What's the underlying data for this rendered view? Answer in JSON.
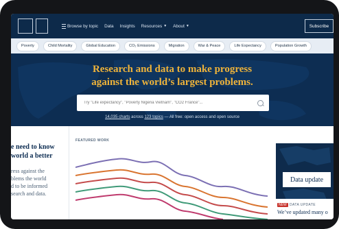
{
  "header": {
    "nav": [
      {
        "label": "Browse by topic",
        "icon": "menu-icon",
        "caret": false
      },
      {
        "label": "Data",
        "caret": false
      },
      {
        "label": "Insights",
        "caret": false
      },
      {
        "label": "Resources",
        "caret": true
      },
      {
        "label": "About",
        "caret": true
      }
    ],
    "subscribe_label": "Subscribe"
  },
  "topics": [
    "Poverty",
    "Child Mortality",
    "Global Education",
    "CO₂ Emissions",
    "Migration",
    "War & Peace",
    "Life Expectancy",
    "Population Growth"
  ],
  "hero": {
    "headline_line1": "Research and data to make progress",
    "headline_line2": "against the world’s largest problems.",
    "search_placeholder": "Try \"Life expectancy\", \"Poverty Nigeria Vietnam\", \"CO2 France\"...",
    "stats_charts": "14,035 charts",
    "stats_across": "across",
    "stats_topics": "123 topics",
    "stats_rest": "— All free: open access and open source"
  },
  "left": {
    "lines_big": [
      "e need to know",
      "world a better"
    ],
    "lines_small": [
      "ress against the",
      "blems the world",
      "d to be informed",
      "search and data."
    ]
  },
  "featured": {
    "label": "FEATURED WORK"
  },
  "card": {
    "label": "Data update",
    "badge_new": "NEW",
    "badge_tag": "DATA UPDATE",
    "title": "We’ve updated many o"
  },
  "colors": {
    "navy": "#0d2a4a",
    "accent_gold": "#f0b43a",
    "chart_lines": [
      "#7b6fb3",
      "#d9742f",
      "#c44a4a",
      "#3f9a78",
      "#bf3a6d"
    ]
  }
}
